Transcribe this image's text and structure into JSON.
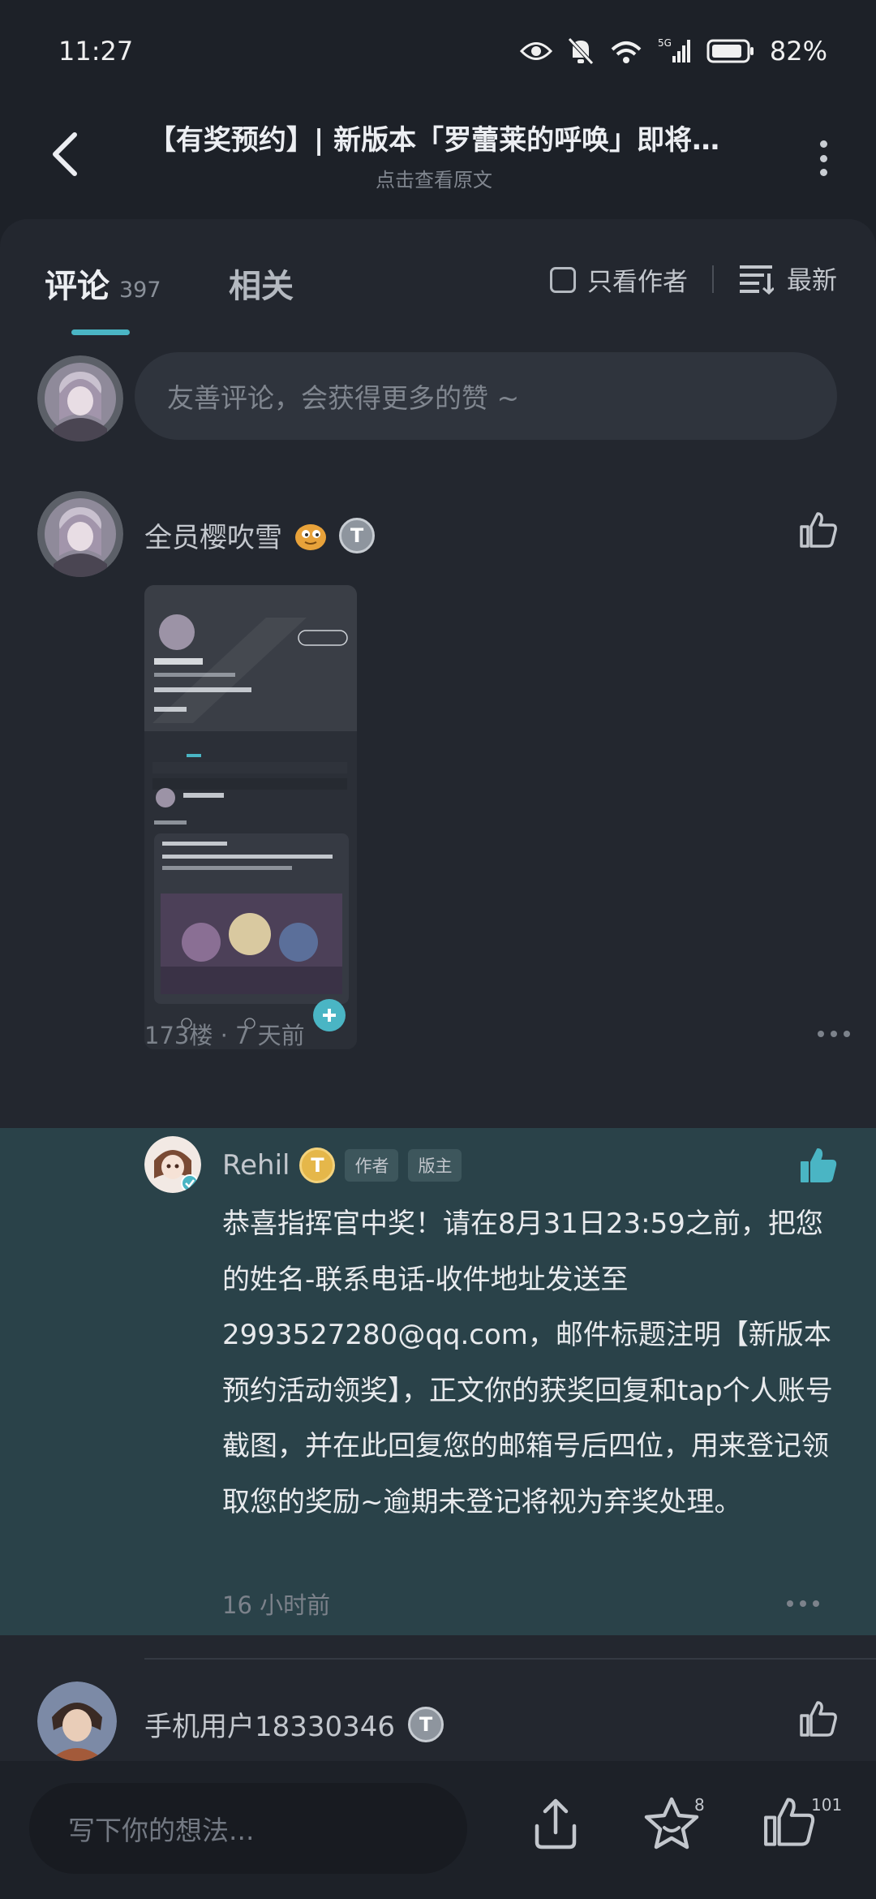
{
  "status_bar": {
    "time": "11:27",
    "battery": "82%",
    "network_wifi": "6",
    "network_cell": "5G"
  },
  "header": {
    "title": "【有奖预约】| 新版本「罗蕾莱的呼唤」即将…",
    "subtitle": "点击查看原文"
  },
  "tabs": {
    "comments_label": "评论",
    "comments_count": "397",
    "related_label": "相关",
    "author_only_label": "只看作者",
    "sort_label": "最新"
  },
  "composer": {
    "placeholder": "友善评论，会获得更多的赞 ~"
  },
  "comments": [
    {
      "user": "全员樱吹雪",
      "badge": "T",
      "floor_time": "173楼 · 7 天前"
    }
  ],
  "reply": {
    "user": "Rehil",
    "badge": "T",
    "tags": [
      "作者",
      "版主"
    ],
    "text": "恭喜指挥官中奖！请在8月31日23:59之前，把您的姓名-联系电话-收件地址发送至2993527280@qq.com，邮件标题注明【新版本预约活动领奖】，正文你的获奖回复和tap个人账号截图，并在此回复您的邮箱号后四位，用来登记领取您的奖励~逾期未登记将视为弃奖处理。",
    "time": "16 小时前"
  },
  "comment_3": {
    "user": "手机用户18330346",
    "badge": "T"
  },
  "bottom_bar": {
    "placeholder": "写下你的想法...",
    "favorite_count": "8",
    "like_count": "101"
  },
  "colors": {
    "accent": "#4ab5c4",
    "background": "#1d2128",
    "card": "#23272f",
    "highlight": "#2a4249"
  }
}
